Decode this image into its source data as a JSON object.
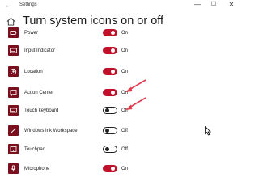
{
  "window": {
    "app_title": "Settings",
    "back_glyph": "←",
    "minimize_glyph": "—",
    "maximize_glyph": "☐",
    "close_glyph": "✕"
  },
  "header": {
    "title": "Turn system icons on or off",
    "icon": "home-icon"
  },
  "accent_color": "#c0102a",
  "tile_color": "#7a0f1e",
  "annotation_color": "#e23a4d",
  "items": [
    {
      "label": "Power",
      "state": "On",
      "icon": "power-icon"
    },
    {
      "label": "Input Indicator",
      "state": "On",
      "icon": "keyboard-icon"
    },
    {
      "label": "Location",
      "state": "On",
      "icon": "location-icon"
    },
    {
      "label": "Action Center",
      "state": "On",
      "icon": "action-center-icon"
    },
    {
      "label": "Touch keyboard",
      "state": "Off",
      "icon": "keyboard-icon"
    },
    {
      "label": "Windows Ink Workspace",
      "state": "Off",
      "icon": "pen-icon"
    },
    {
      "label": "Touchpad",
      "state": "Off",
      "icon": "touchpad-icon"
    },
    {
      "label": "Microphone",
      "state": "On",
      "icon": "microphone-icon"
    }
  ]
}
